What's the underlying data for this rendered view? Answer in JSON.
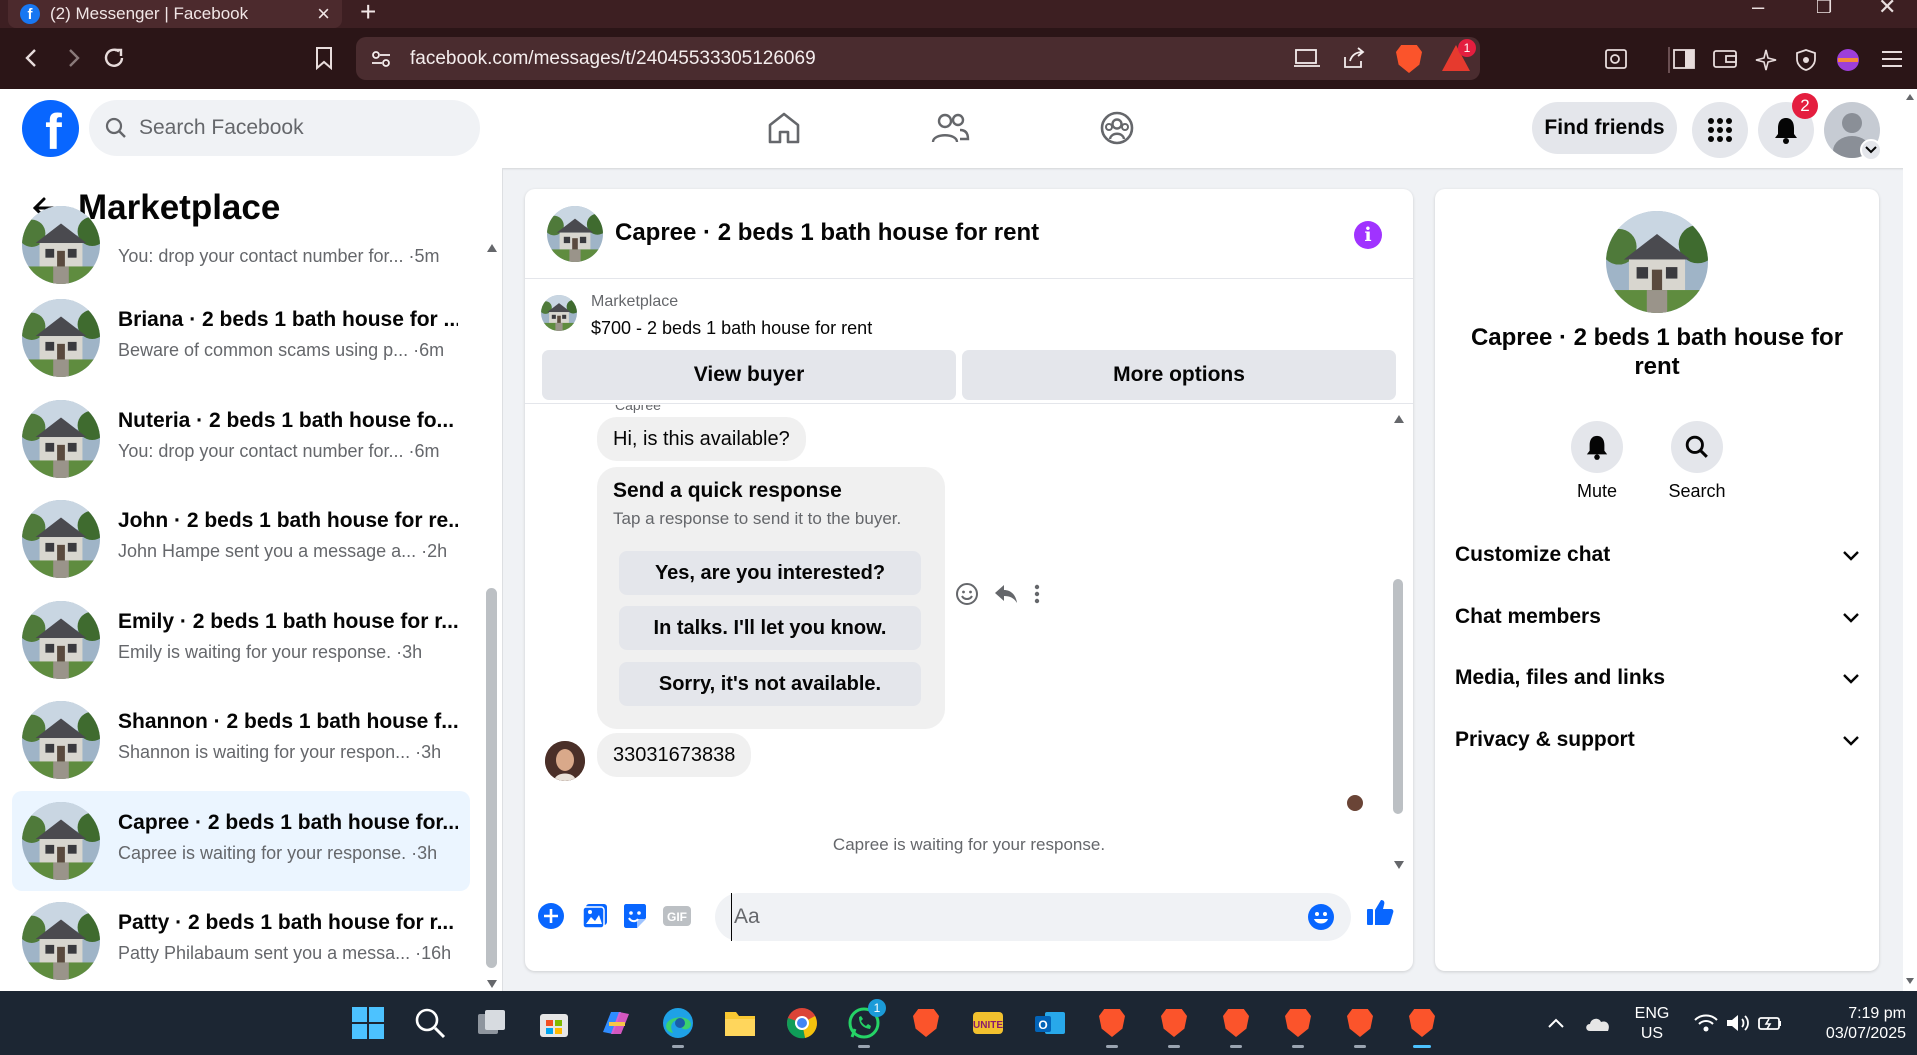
{
  "browser": {
    "tab_title": "(2) Messenger | Facebook",
    "url": "facebook.com/messages/t/24045533305126069",
    "brave_rewards_badge": "1"
  },
  "header": {
    "search_placeholder": "Search Facebook",
    "find_friends_label": "Find friends",
    "notifications_count": "2"
  },
  "sidebar": {
    "title": "Marketplace",
    "conversations": [
      {
        "name": "",
        "preview": "You: drop your contact number for... ·5m"
      },
      {
        "name": "Briana · 2 beds 1 bath house for ...",
        "preview": "Beware of common scams using p... ·6m"
      },
      {
        "name": "Nuteria · 2 beds 1 bath house fo...",
        "preview": "You: drop your contact number for... ·6m"
      },
      {
        "name": "John · 2 beds 1 bath house for re...",
        "preview": "John Hampe sent you a message a... ·2h"
      },
      {
        "name": "Emily · 2 beds 1 bath house for r...",
        "preview": "Emily is waiting for your response. ·3h"
      },
      {
        "name": "Shannon · 2 beds 1 bath house f...",
        "preview": "Shannon is waiting for your respon... ·3h"
      },
      {
        "name": "Capree · 2 beds 1 bath house for...",
        "preview": "Capree is waiting for your response. ·3h"
      },
      {
        "name": "Patty · 2 beds 1 bath house for r...",
        "preview": "Patty Philabaum sent you a messa... ·16h"
      }
    ]
  },
  "chat": {
    "title": "Capree · 2 beds 1 bath house for rent",
    "listing_source": "Marketplace",
    "listing_price_title": "$700 - 2 beds 1 bath house for rent",
    "view_buyer_label": "View buyer",
    "more_options_label": "More options",
    "sender_label": "Capree",
    "first_message": "Hi, is this available?",
    "quick_response_title": "Send a quick response",
    "quick_response_subtitle": "Tap a response to send it to the buyer.",
    "quick_responses": [
      "Yes, are you interested?",
      "In talks. I'll let you know.",
      "Sorry, it's not available."
    ],
    "phone_message": "33031673838",
    "waiting_text": "Capree is waiting for your response.",
    "composer_placeholder": "Aa"
  },
  "right_panel": {
    "title": "Capree · 2 beds 1 bath house for rent",
    "mute_label": "Mute",
    "search_label": "Search",
    "sections": [
      "Customize chat",
      "Chat members",
      "Media, files and links",
      "Privacy & support"
    ]
  },
  "taskbar": {
    "lang_line1": "ENG",
    "lang_line2": "US",
    "time": "7:19 pm",
    "date": "03/07/2025",
    "whatsapp_badge": "1"
  },
  "colors": {
    "facebook_blue": "#0866ff",
    "messenger_purple": "#a033ff",
    "active_row": "#ebf5ff",
    "browser_chrome": "#2b1517"
  }
}
